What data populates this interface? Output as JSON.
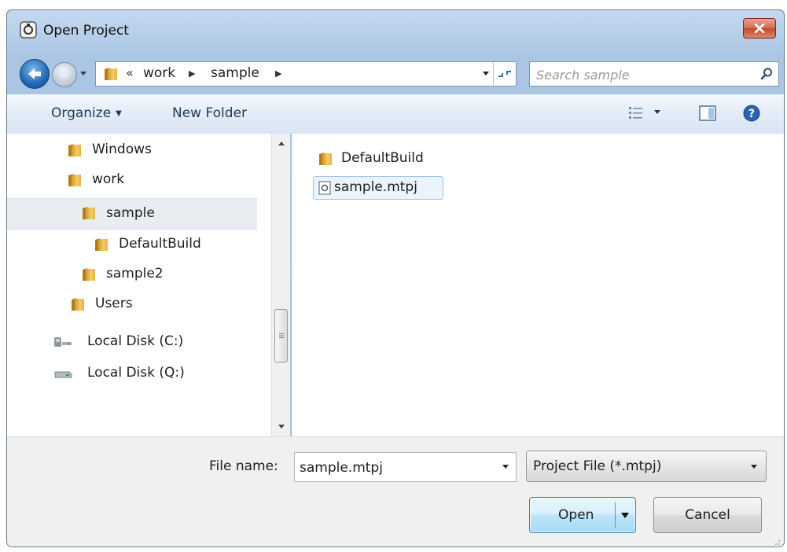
{
  "window": {
    "title": "Open Project"
  },
  "address": {
    "overflow": "«",
    "crumbs": [
      "work",
      "sample"
    ]
  },
  "search": {
    "placeholder": "Search sample"
  },
  "toolbar": {
    "organize_label": "Organize",
    "new_folder_label": "New Folder"
  },
  "nav_tree": [
    {
      "label": "Windows",
      "icon": "folder-icon"
    },
    {
      "label": "work",
      "icon": "folder-icon"
    },
    {
      "label": "sample",
      "icon": "folder-icon",
      "selected": true
    },
    {
      "label": "DefaultBuild",
      "icon": "folder-icon"
    },
    {
      "label": "sample2",
      "icon": "folder-icon"
    },
    {
      "label": "Users",
      "icon": "folder-icon"
    },
    {
      "label": "Local Disk (C:)",
      "icon": "hard-drive-icon"
    },
    {
      "label": "Local Disk (Q:)",
      "icon": "network-drive-icon"
    }
  ],
  "files": [
    {
      "label": "DefaultBuild",
      "icon": "folder-icon"
    },
    {
      "label": "sample.mtpj",
      "icon": "project-file-icon",
      "selected": true
    }
  ],
  "bottom": {
    "filename_label": "File name:",
    "filename_value": "sample.mtpj",
    "filetype_value": "Project File (*.mtpj)",
    "open_label": "Open",
    "cancel_label": "Cancel"
  },
  "colors": {
    "frame": "#aac6e4",
    "toolbar_text": "#1e395b",
    "selection": "#e8edf2",
    "close_button": "#d36b50"
  }
}
